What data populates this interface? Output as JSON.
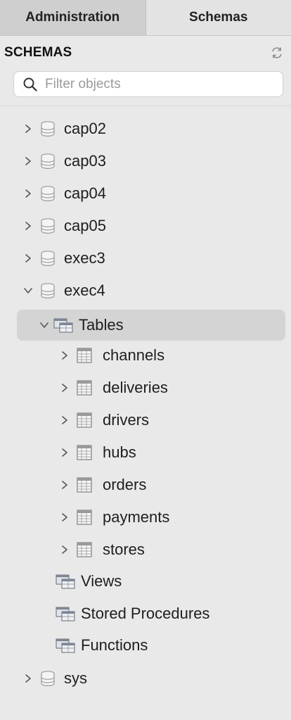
{
  "tabs": {
    "administration": "Administration",
    "schemas": "Schemas"
  },
  "header": {
    "title": "SCHEMAS"
  },
  "search": {
    "placeholder": "Filter objects"
  },
  "tree": {
    "cap02": "cap02",
    "cap03": "cap03",
    "cap04": "cap04",
    "cap05": "cap05",
    "exec3": "exec3",
    "exec4": "exec4",
    "tables": "Tables",
    "table_names": [
      "channels",
      "deliveries",
      "drivers",
      "hubs",
      "orders",
      "payments",
      "stores"
    ],
    "views": "Views",
    "stored_procedures": "Stored Procedures",
    "functions": "Functions",
    "sys": "sys"
  },
  "colors": {
    "selected_row": "#d4d4d4",
    "panel_bg": "#e9e9e9",
    "tab_active_bg": "#cfcfcf"
  },
  "icons": [
    "refresh-icon",
    "search-icon",
    "database-icon",
    "folder-icon",
    "table-icon",
    "chevron-right-icon",
    "chevron-down-icon"
  ]
}
